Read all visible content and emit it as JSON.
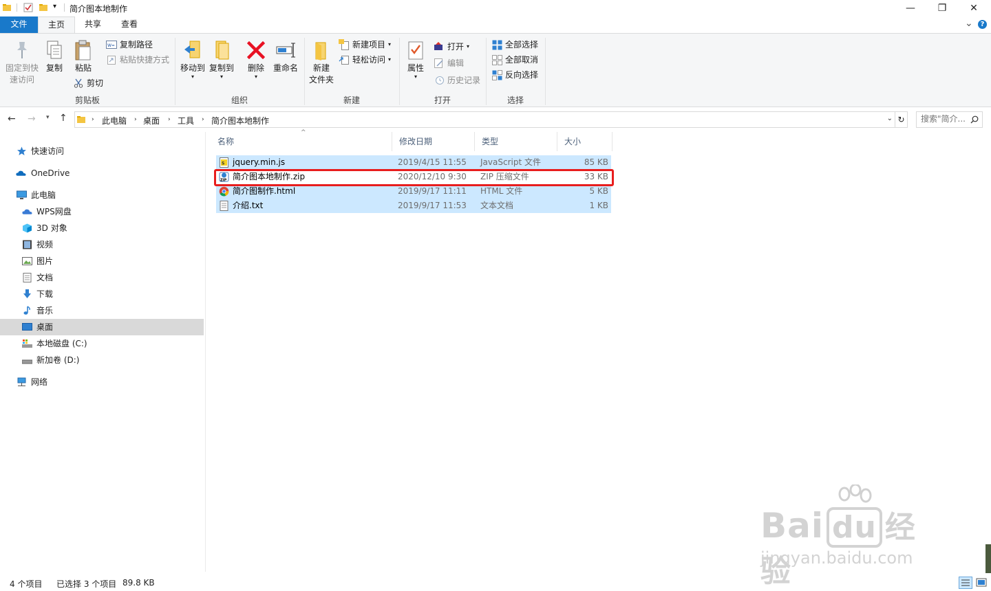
{
  "window": {
    "title": "简介图本地制作",
    "minimize": "—",
    "maximize": "❐",
    "close": "✕"
  },
  "tabs": {
    "file": "文件",
    "home": "主页",
    "share": "共享",
    "view": "查看",
    "expand": "⌄",
    "help": "?"
  },
  "ribbon": {
    "clipboard": {
      "pin_label": "固定到快速访问",
      "pin_line1": "固定到快",
      "pin_line2": "速访问",
      "copy_label": "复制",
      "paste_label": "粘贴",
      "copy_path": "复制路径",
      "paste_shortcut": "粘贴快捷方式",
      "cut": "剪切",
      "group_label": "剪贴板"
    },
    "organize": {
      "move_to": "移动到",
      "copy_to": "复制到",
      "delete": "删除",
      "rename": "重命名",
      "group_label": "组织"
    },
    "new": {
      "new_folder_line1": "新建",
      "new_folder_line2": "文件夹",
      "new_item": "新建项目",
      "easy_access": "轻松访问",
      "group_label": "新建"
    },
    "open": {
      "properties": "属性",
      "open": "打开",
      "edit": "编辑",
      "history": "历史记录",
      "group_label": "打开"
    },
    "select": {
      "select_all": "全部选择",
      "select_none": "全部取消",
      "invert": "反向选择",
      "group_label": "选择"
    }
  },
  "address": {
    "crumbs": [
      "此电脑",
      "桌面",
      "工具",
      "简介图本地制作"
    ],
    "search_placeholder": "搜索\"简介...",
    "refresh": "↻"
  },
  "nav": {
    "quick_access": "快速访问",
    "onedrive": "OneDrive",
    "this_pc": "此电脑",
    "items": [
      "WPS网盘",
      "3D 对象",
      "视频",
      "图片",
      "文档",
      "下载",
      "音乐",
      "桌面",
      "本地磁盘 (C:)",
      "新加卷 (D:)"
    ],
    "network": "网络",
    "selected": "桌面"
  },
  "columns": {
    "name": "名称",
    "date": "修改日期",
    "type": "类型",
    "size": "大小"
  },
  "files": [
    {
      "name": "jquery.min.js",
      "date": "2019/4/15 11:55",
      "type": "JavaScript 文件",
      "size": "85 KB",
      "icon": "js-file-icon",
      "selected": true
    },
    {
      "name": "简介图本地制作.zip",
      "date": "2020/12/10 9:30",
      "type": "ZIP 压缩文件",
      "size": "33 KB",
      "icon": "zip-file-icon",
      "selected": false
    },
    {
      "name": "简介图制作.html",
      "date": "2019/9/17 11:11",
      "type": "HTML 文件",
      "size": "5 KB",
      "icon": "chrome-html-icon",
      "selected": true
    },
    {
      "name": "介绍.txt",
      "date": "2019/9/17 11:53",
      "type": "文本文档",
      "size": "1 KB",
      "icon": "text-file-icon",
      "selected": true
    }
  ],
  "status": {
    "count": "4 个项目",
    "selection": "已选择 3 个项目",
    "size": "89.8 KB"
  },
  "watermark": {
    "brand": "Bai",
    "brand2": "经验",
    "url": "jingyan.baidu.com"
  },
  "colors": {
    "accent": "#1979ca",
    "selection": "#cce8ff",
    "highlight_box": "#e81d1d"
  }
}
